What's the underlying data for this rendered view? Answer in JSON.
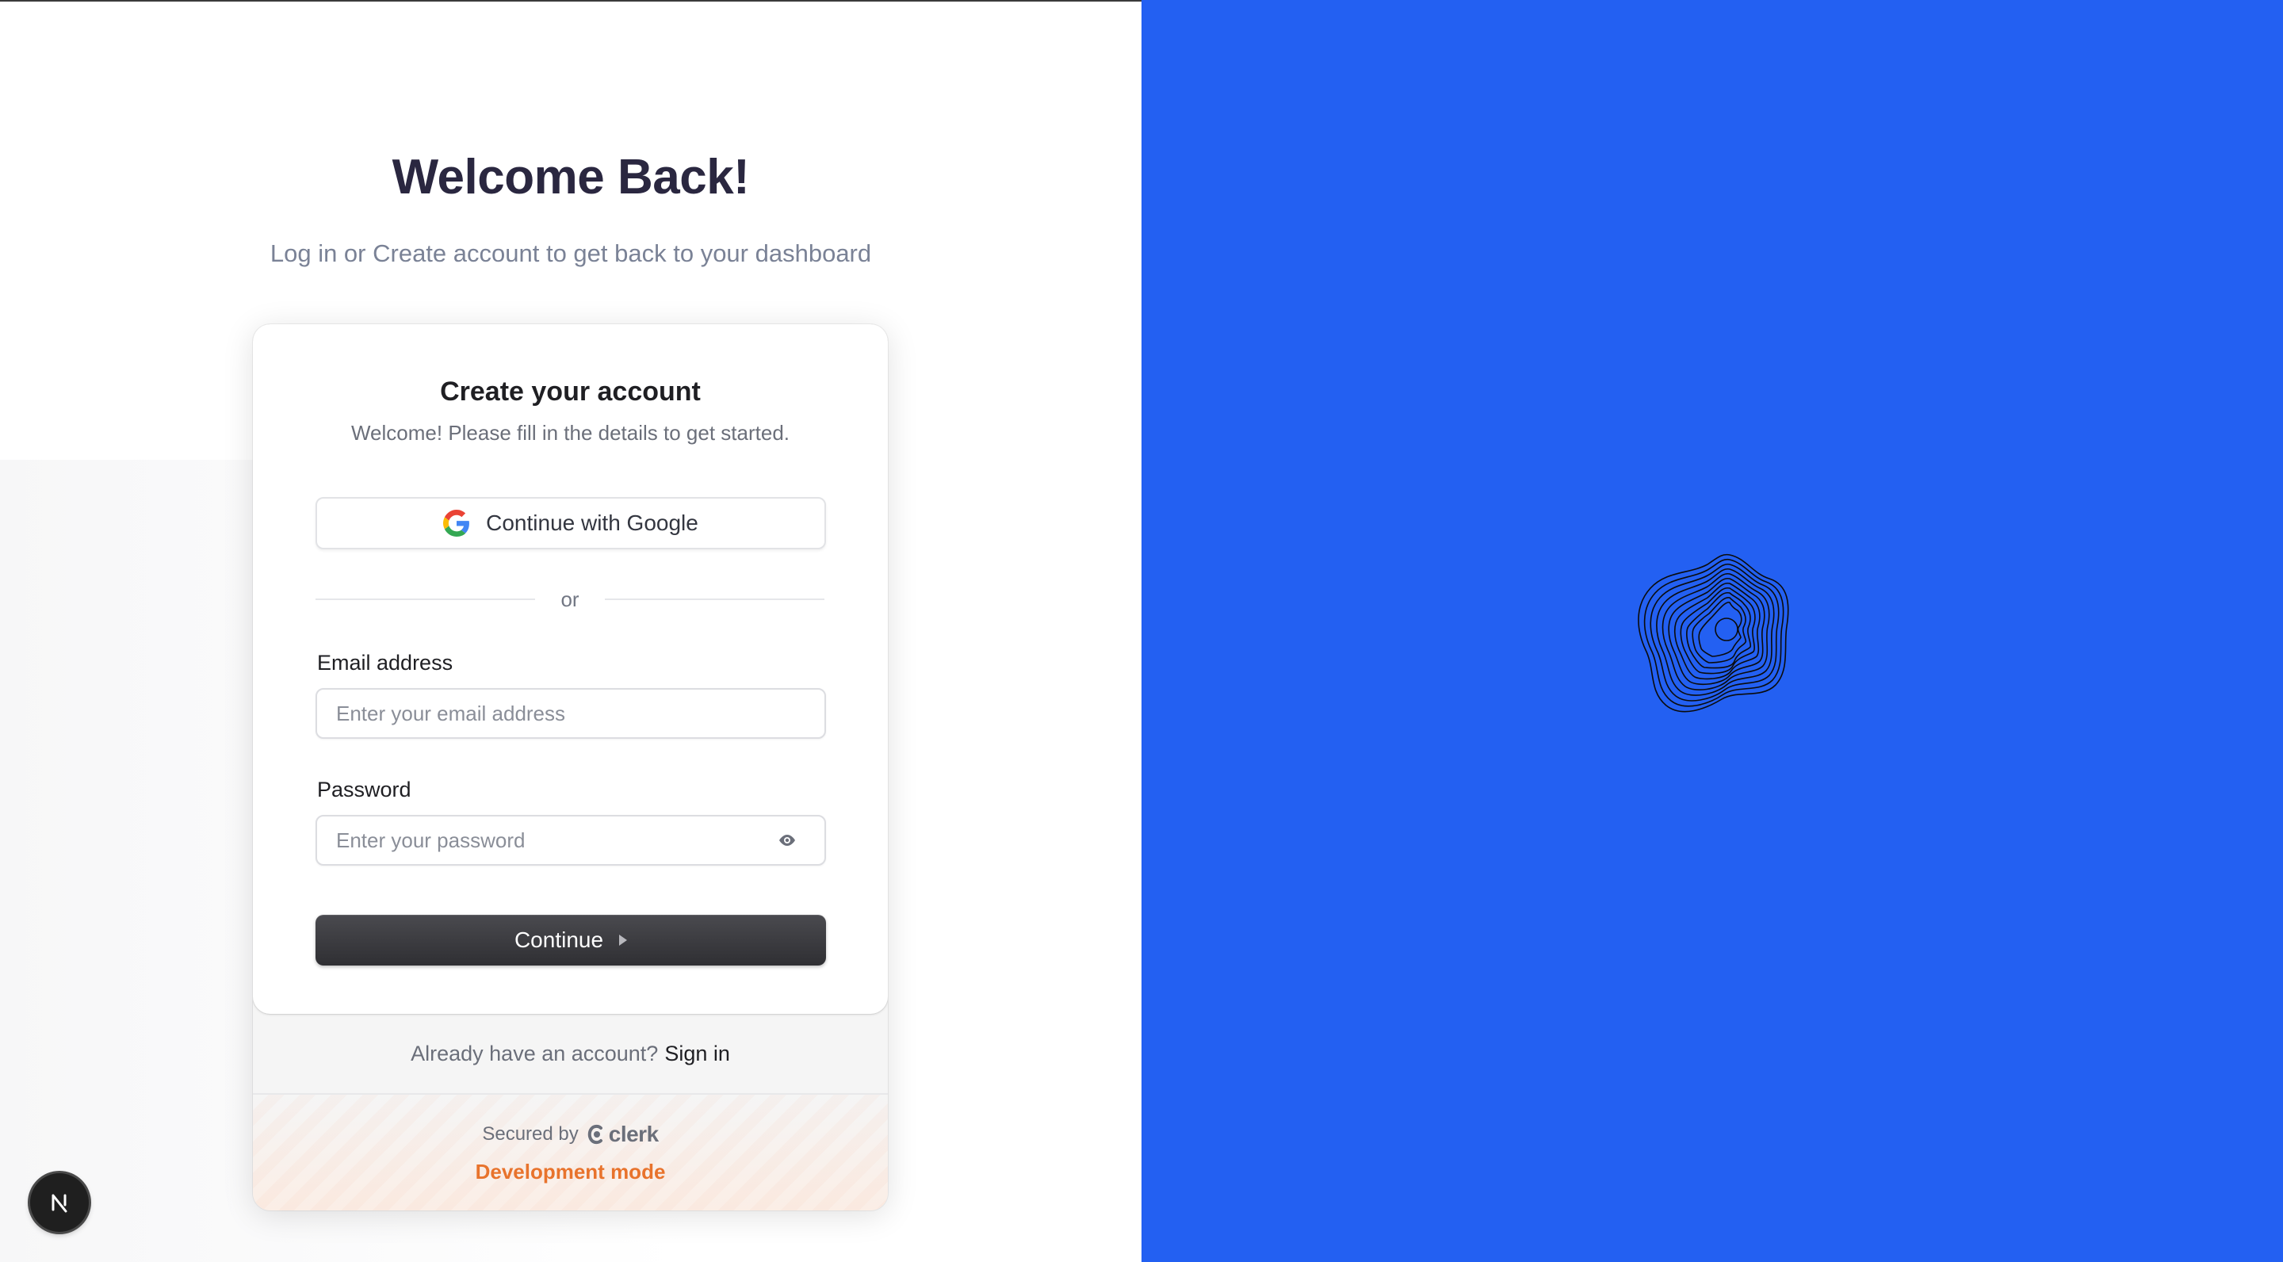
{
  "page": {
    "heading": "Welcome Back!",
    "subheading": "Log in or Create account to get back to your dashboard"
  },
  "card": {
    "title": "Create your account",
    "subtitle": "Welcome! Please fill in the details to get started.",
    "google_button_label": "Continue with Google",
    "divider_text": "or",
    "email": {
      "label": "Email address",
      "placeholder": "Enter your email address",
      "value": ""
    },
    "password": {
      "label": "Password",
      "placeholder": "Enter your password",
      "value": ""
    },
    "continue_label": "Continue",
    "footer_question": "Already have an account?",
    "footer_link": "Sign in",
    "secured_by": "Secured by",
    "brand": "clerk",
    "dev_mode": "Development mode"
  },
  "icons": {
    "google": "google-icon",
    "eye": "eye-icon",
    "arrow": "caret-right-icon",
    "clerk": "clerk-logo-icon",
    "nextjs": "nextjs-icon",
    "hero": "concentric-blob-graphic"
  },
  "colors": {
    "right_panel": "#2360f2",
    "heading": "#2a2740",
    "primary_button": "#2f2f33",
    "dev_mode": "#e8732c"
  }
}
